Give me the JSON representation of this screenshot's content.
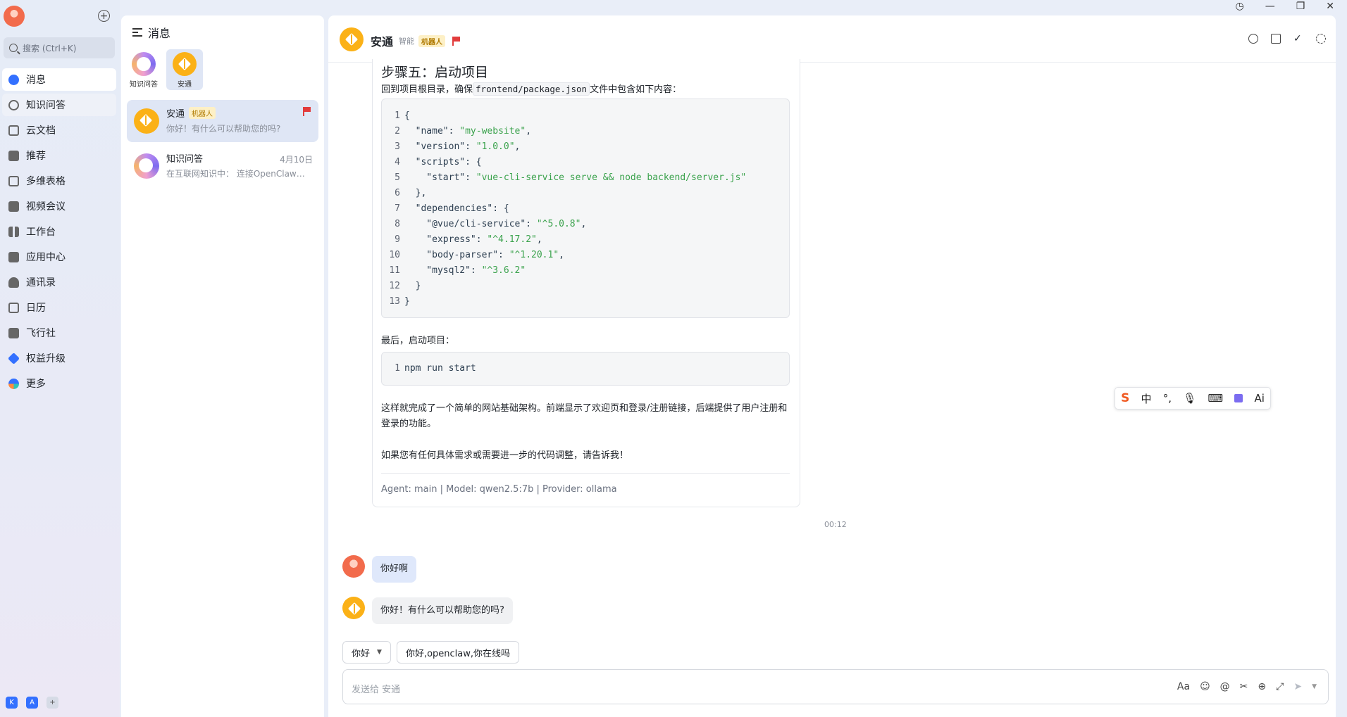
{
  "nav": {
    "search_placeholder": "搜索 (Ctrl+K)",
    "items": [
      {
        "label": "消息",
        "icon": "chat-bubble-icon"
      },
      {
        "label": "知识问答",
        "icon": "qa-ring-icon"
      },
      {
        "label": "云文档",
        "icon": "cloud-doc-icon"
      },
      {
        "label": "推荐",
        "icon": "gift-icon"
      },
      {
        "label": "多维表格",
        "icon": "table-icon"
      },
      {
        "label": "视频会议",
        "icon": "video-icon"
      },
      {
        "label": "工作台",
        "icon": "grid-icon"
      },
      {
        "label": "应用中心",
        "icon": "bag-icon"
      },
      {
        "label": "通讯录",
        "icon": "contacts-icon"
      },
      {
        "label": "日历",
        "icon": "calendar-icon"
      },
      {
        "label": "飞行社",
        "icon": "book-icon"
      },
      {
        "label": "权益升级",
        "icon": "diamond-icon"
      },
      {
        "label": "更多",
        "icon": "more-apps-icon"
      }
    ],
    "bottom": [
      "K",
      "A",
      "+"
    ]
  },
  "list": {
    "title": "消息",
    "pinned": [
      {
        "label": "知识问答"
      },
      {
        "label": "安通"
      }
    ],
    "conversations": [
      {
        "name": "安通",
        "tag": "机器人",
        "preview": "你好！有什么可以帮助您的吗?",
        "date": ""
      },
      {
        "name": "知识问答",
        "tag": "",
        "preview": "在互联网知识中： 连接OpenClaw可...",
        "date": "4月10日"
      }
    ]
  },
  "chat": {
    "title": "安通",
    "subtitle": "智能",
    "tag": "机器人",
    "step_heading": "步骤五：启动项目",
    "intro_before": "回到项目根目录，确保",
    "intro_code": "frontend/package.json",
    "intro_after": "文件中包含如下内容：",
    "code_lines": [
      {
        "n": "1",
        "t": "{"
      },
      {
        "n": "2",
        "k": "  \"name\": ",
        "s": "\"my-website\"",
        "e": ","
      },
      {
        "n": "3",
        "k": "  \"version\": ",
        "s": "\"1.0.0\"",
        "e": ","
      },
      {
        "n": "4",
        "t": "  \"scripts\": {"
      },
      {
        "n": "5",
        "k": "    \"start\": ",
        "s": "\"vue-cli-service serve && node backend/server.js\"",
        "e": ""
      },
      {
        "n": "6",
        "t": "  },"
      },
      {
        "n": "7",
        "t": "  \"dependencies\": {"
      },
      {
        "n": "8",
        "k": "    \"@vue/cli-service\": ",
        "s": "\"^5.0.8\"",
        "e": ","
      },
      {
        "n": "9",
        "k": "    \"express\": ",
        "s": "\"^4.17.2\"",
        "e": ","
      },
      {
        "n": "10",
        "k": "    \"body-parser\": ",
        "s": "\"^1.20.1\"",
        "e": ","
      },
      {
        "n": "11",
        "k": "    \"mysql2\": ",
        "s": "\"^3.6.2\"",
        "e": ""
      },
      {
        "n": "12",
        "t": "  }"
      },
      {
        "n": "13",
        "t": "}"
      }
    ],
    "last_label": "最后，启动项目：",
    "cmd_line_no": "1",
    "cmd": "npm run start",
    "summary": "这样就完成了一个简单的网站基础架构。前端显示了欢迎页和登录/注册链接，后端提供了用户注册和登录的功能。",
    "closing": "如果您有任何具体需求或需要进一步的代码调整，请告诉我！",
    "meta": "Agent: main | Model: qwen2.5:7b | Provider: ollama",
    "time": "00:12",
    "user_msg": "你好啊",
    "bot_msg": "你好！有什么可以帮助您的吗?",
    "chips": [
      "你好",
      "你好,openclaw,你在线吗"
    ],
    "input_placeholder": "发送给 安通"
  },
  "ime": [
    "中",
    "°,",
    "mic",
    "keyboard",
    "skin",
    "Ai"
  ],
  "colors": {
    "accent": "#3370ff",
    "brand_yellow": "#fbb117",
    "flag": "#e23c3c",
    "code_string": "#3aa24c"
  }
}
